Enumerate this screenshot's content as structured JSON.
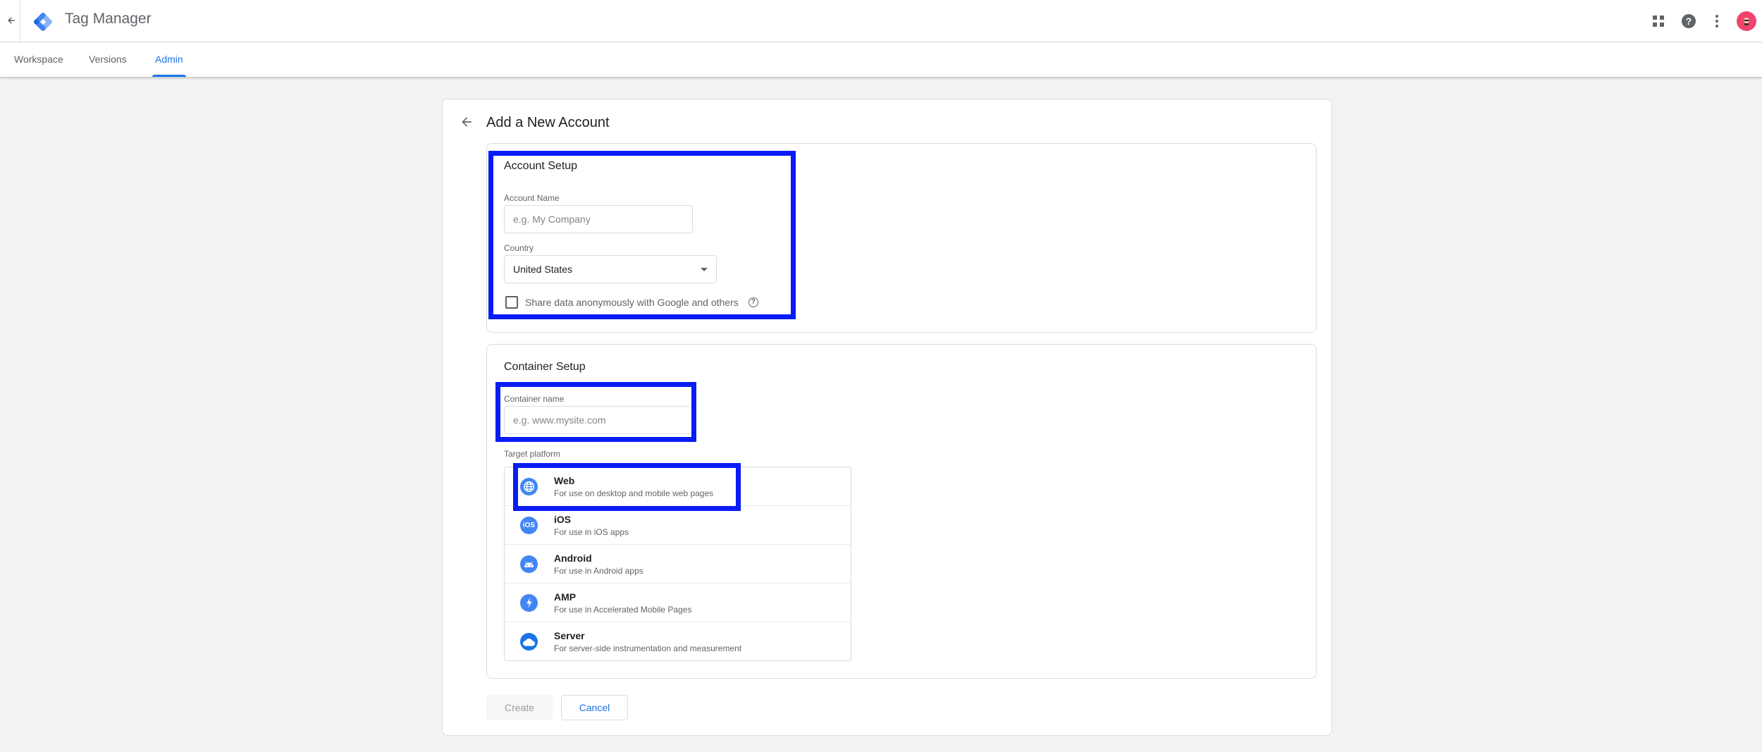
{
  "app": {
    "title": "Tag Manager",
    "brand_color": "#1a73e8",
    "icons": {
      "back": "arrow-left-icon",
      "logo": "tag-manager-logo",
      "apps": "apps-grid-icon",
      "help": "help-circle-icon",
      "more": "more-vert-icon",
      "avatar": "user-avatar"
    }
  },
  "tabs": [
    {
      "label": "Workspace",
      "active": false
    },
    {
      "label": "Versions",
      "active": false
    },
    {
      "label": "Admin",
      "active": true
    }
  ],
  "page": {
    "title": "Add a New Account"
  },
  "account_setup": {
    "title": "Account Setup",
    "account_name": {
      "label": "Account Name",
      "placeholder": "e.g. My Company",
      "value": ""
    },
    "country": {
      "label": "Country",
      "value": "United States"
    },
    "share_data": {
      "label": "Share data anonymously with Google and others",
      "checked": false
    }
  },
  "container_setup": {
    "title": "Container Setup",
    "container_name": {
      "label": "Container name",
      "placeholder": "e.g. www.mysite.com",
      "value": ""
    },
    "target_platform_label": "Target platform",
    "platforms": [
      {
        "name": "Web",
        "description": "For use on desktop and mobile web pages",
        "icon": "globe-icon"
      },
      {
        "name": "iOS",
        "description": "For use in iOS apps",
        "icon": "ios-icon"
      },
      {
        "name": "Android",
        "description": "For use in Android apps",
        "icon": "android-icon"
      },
      {
        "name": "AMP",
        "description": "For use in Accelerated Mobile Pages",
        "icon": "bolt-icon"
      },
      {
        "name": "Server",
        "description": "For server-side instrumentation and measurement",
        "icon": "cloud-icon"
      }
    ]
  },
  "actions": {
    "create_label": "Create",
    "create_disabled": true,
    "cancel_label": "Cancel"
  },
  "highlight_color": "#0a1cf5"
}
